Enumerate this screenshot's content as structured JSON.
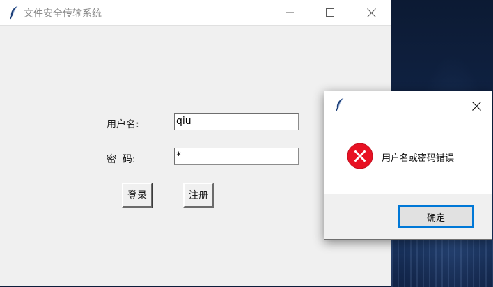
{
  "main_window": {
    "title": "文件安全传输系统",
    "form": {
      "username_label": "用户名:",
      "username_value": "qiu",
      "password_label": "密  码:",
      "password_value": "*",
      "login_label": "登录",
      "register_label": "注册"
    }
  },
  "dialog": {
    "message": "用户名或密码错误",
    "ok_label": "确定",
    "icon": "error-icon"
  },
  "colors": {
    "window_bg": "#f0f0f0",
    "error_red": "#e81123",
    "focus_blue": "#0078d7"
  }
}
